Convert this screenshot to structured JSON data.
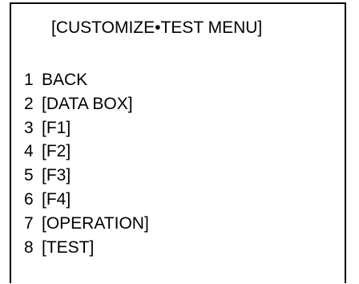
{
  "menu": {
    "title": "[CUSTOMIZE•TEST MENU]",
    "items": [
      {
        "num": "1",
        "label": "BACK"
      },
      {
        "num": "2",
        "label": "[DATA BOX]"
      },
      {
        "num": "3",
        "label": "[F1]"
      },
      {
        "num": "4",
        "label": "[F2]"
      },
      {
        "num": "5",
        "label": "[F3]"
      },
      {
        "num": "6",
        "label": "[F4]"
      },
      {
        "num": "7",
        "label": "[OPERATION]"
      },
      {
        "num": "8",
        "label": "[TEST]"
      }
    ]
  }
}
